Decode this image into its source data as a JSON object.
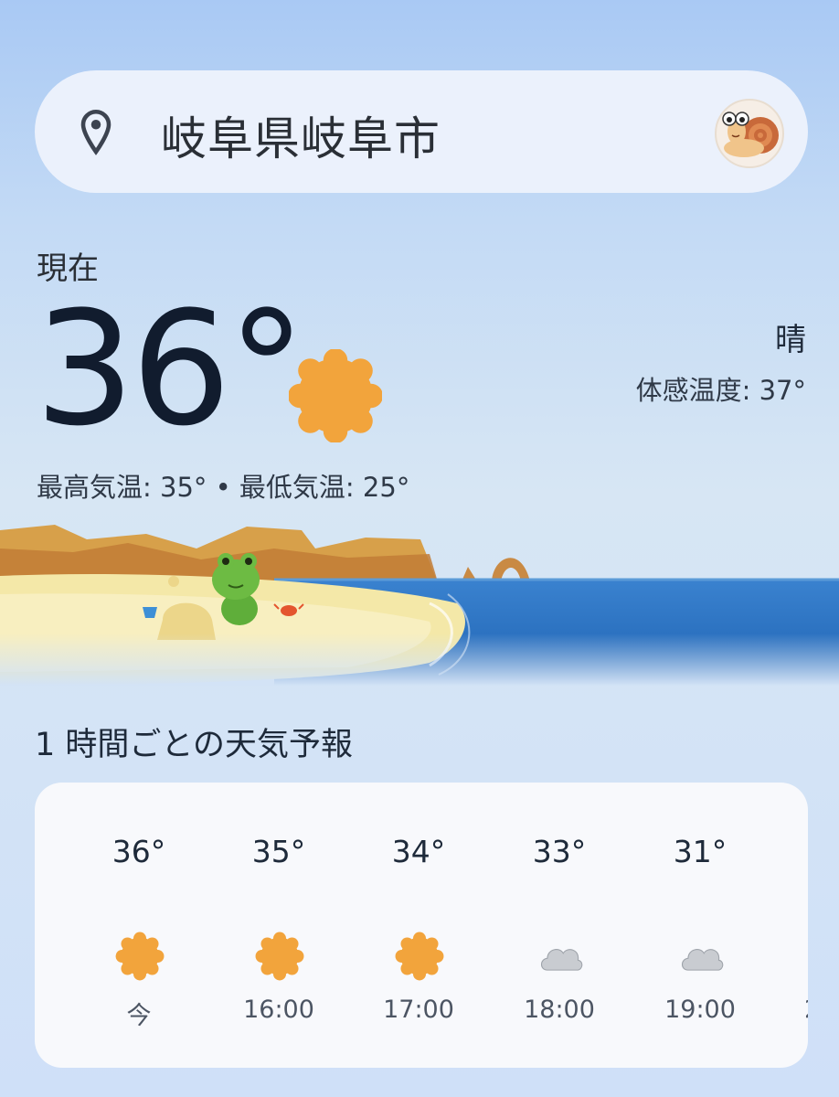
{
  "search": {
    "location": "岐阜県岐阜市"
  },
  "current": {
    "label": "現在",
    "temp": "36°",
    "condition": "晴",
    "feels_like": "体感温度: 37°",
    "high_low": "最高気温: 35° • 最低気温: 25°"
  },
  "hourly": {
    "title": "1 時間ごとの天気予報",
    "items": [
      {
        "temp": "36°",
        "time": "今",
        "icon": "sun-icon"
      },
      {
        "temp": "35°",
        "time": "16:00",
        "icon": "sun-icon"
      },
      {
        "temp": "34°",
        "time": "17:00",
        "icon": "sun-icon"
      },
      {
        "temp": "33°",
        "time": "18:00",
        "icon": "cloud-icon"
      },
      {
        "temp": "31°",
        "time": "19:00",
        "icon": "cloud-icon"
      }
    ],
    "next_partial": "2"
  },
  "colors": {
    "sun": "#f2a43c",
    "sea": "#2f76c5",
    "sand": "#f3e6a6",
    "text_dark": "#111c2e"
  }
}
